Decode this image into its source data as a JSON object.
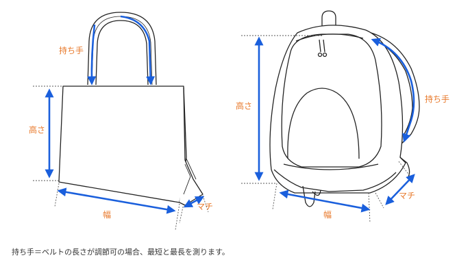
{
  "colors": {
    "label": "#e8792b",
    "arrow": "#1a5fdc",
    "outline": "#222222",
    "dim_line": "#555555",
    "note_text": "#333333"
  },
  "tote": {
    "handle_label": "持ち手",
    "height_label": "高さ",
    "width_label": "幅",
    "gusset_label": "マチ"
  },
  "backpack": {
    "height_label": "高さ",
    "handle_label": "持ち手",
    "width_label": "幅",
    "gusset_label": "マチ"
  },
  "footnote": "持ち手＝ベルトの長さが調節可の場合、最短と最長を測ります。"
}
